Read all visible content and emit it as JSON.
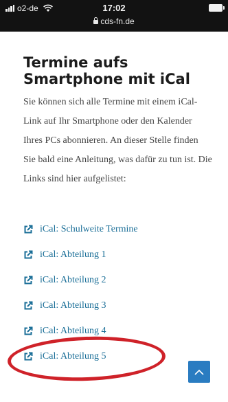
{
  "status_bar": {
    "carrier": "o2-de",
    "time": "17:02",
    "url": "cds-fn.de"
  },
  "page": {
    "title": "Termine aufs Smartphone mit iCal",
    "intro": "Sie können sich alle Termine mit einem iCal-Link auf Ihr Smartphone oder den Kalender Ihres PCs abonnieren. An dieser Stelle finden Sie bald eine Anleitung, was dafür zu tun ist. Die Links sind hier aufgelistet:"
  },
  "links": [
    {
      "label": "iCal: Schulweite Termine",
      "icon": "external-link-icon"
    },
    {
      "label": "iCal: Abteilung 1",
      "icon": "external-link-icon"
    },
    {
      "label": "iCal: Abteilung 2",
      "icon": "external-link-icon"
    },
    {
      "label": "iCal: Abteilung 3",
      "icon": "external-link-icon"
    },
    {
      "label": "iCal: Abteilung 4",
      "icon": "external-link-icon"
    },
    {
      "label": "iCal: Abteilung 5",
      "icon": "external-link-icon"
    }
  ],
  "colors": {
    "link": "#1a6e97",
    "annotation": "#cf2229",
    "scroll_top_button": "#2a7cc1"
  }
}
